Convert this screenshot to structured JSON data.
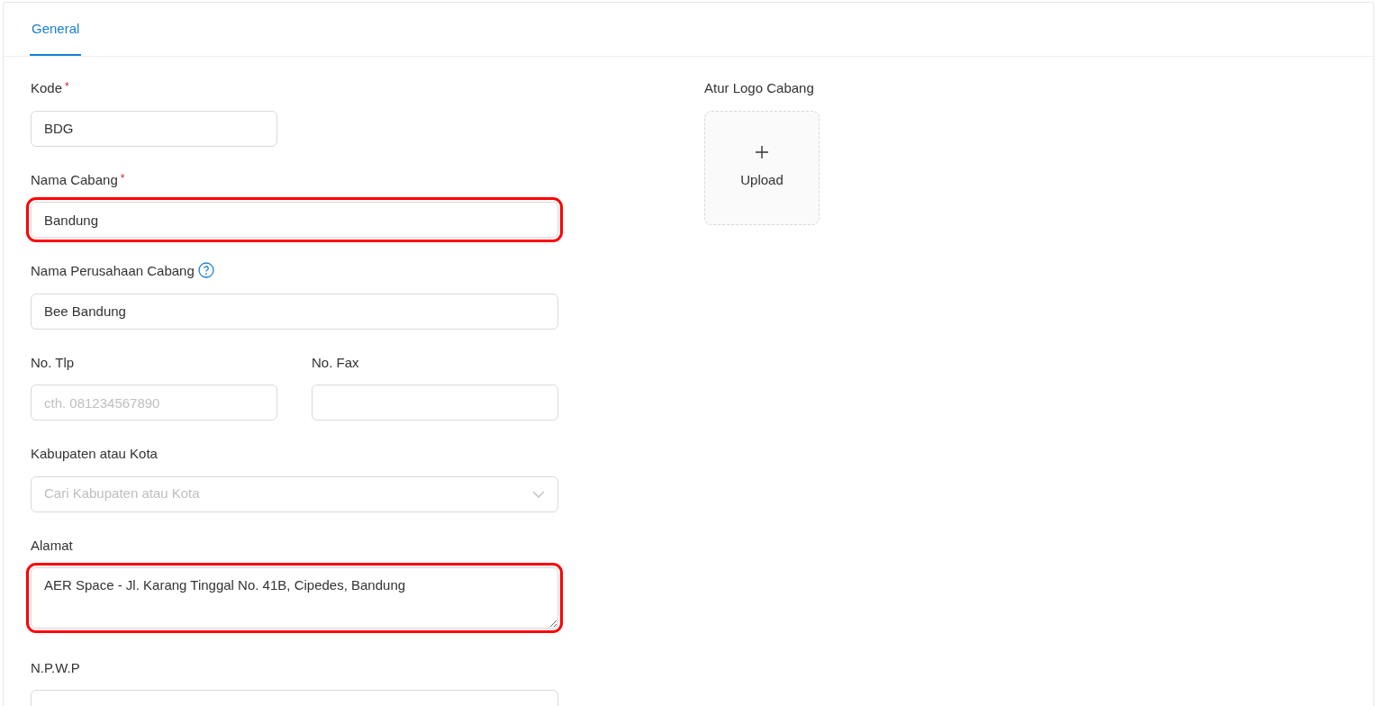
{
  "tabs": [
    {
      "label": "General",
      "selected": true
    }
  ],
  "form_rows": [
    {
      "fields": [
        {
          "kind": "text",
          "label": "Kode",
          "required_mark": "*",
          "value": "BDG",
          "highlighted": false
        }
      ]
    },
    {
      "fields": [
        {
          "kind": "text",
          "label": "Nama Cabang",
          "required_mark": "*",
          "value": "Bandung",
          "highlighted": true
        }
      ]
    },
    {
      "fields": [
        {
          "kind": "text",
          "label": "Nama Perusahaan Cabang",
          "help": true,
          "value": "Bee Bandung",
          "highlighted": false
        }
      ]
    },
    {
      "fields": [
        {
          "kind": "text",
          "label": "No. Tlp",
          "placeholder": "cth. 081234567890",
          "highlighted": false
        },
        {
          "kind": "text",
          "label": "No. Fax",
          "highlighted": false
        }
      ]
    },
    {
      "fields": [
        {
          "kind": "select",
          "label": "Kabupaten atau Kota",
          "placeholder": "Cari Kabupaten atau Kota",
          "highlighted": false
        }
      ]
    },
    {
      "fields": [
        {
          "kind": "textarea",
          "label": "Alamat",
          "value": "AER Space - Jl. Karang Tinggal No. 41B, Cipedes, Bandung",
          "highlighted": true
        }
      ]
    },
    {
      "fields": [
        {
          "kind": "text",
          "label": "N.P.W.P",
          "highlighted": false
        }
      ]
    }
  ],
  "logo": {
    "label": "Atur Logo Cabang",
    "button": "Upload"
  }
}
